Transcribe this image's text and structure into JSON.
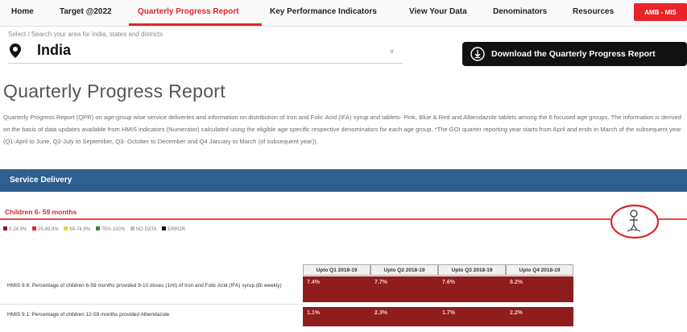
{
  "nav": {
    "items": [
      {
        "label": "Home"
      },
      {
        "label": "Target @2022"
      },
      {
        "label": "Quarterly Progress Report"
      },
      {
        "label": "Key Performance Indicators"
      },
      {
        "label": "View Your Data"
      },
      {
        "label": "Denominators"
      },
      {
        "label": "Resources"
      }
    ],
    "active_index": 2,
    "amb_label": "AMB - MIS"
  },
  "selector": {
    "breadcrumb": "Select / Search your area for India, states and districts",
    "value": "India",
    "chevron": "˅",
    "icon": "location-pin-icon"
  },
  "download": {
    "label": "Download the Quarterly Progress Report",
    "icon": "download-icon"
  },
  "page": {
    "title": "Quarterly Progress Report",
    "description": "Quarterly Progress Report (QPR) on age-group wise service deliveries and information on distribution of Iron and Folic Acid (IFA) syrup and tablets- Pink, Blue & Red and Albendazole tablets among the 6 focused age groups. The information is derived on the basis of data updates available from HMIS indicators (Numerator) calculated using the eligible age specific respective denominators for each age group. *The GOI quarter reporting year starts from April and ends in March of the subsequent year (Q1-April to June, Q2-July to September, Q3- October to December and Q4 January to March (of subsequent year))."
  },
  "service_delivery": {
    "label": "Service Delivery"
  },
  "section": {
    "title": "Children 6- 59 months",
    "emblem_icon": "child-emblem-icon"
  },
  "legend": [
    {
      "label": "0-24.9%",
      "color": "#8f1d1d"
    },
    {
      "label": "25-49.9%",
      "color": "#e8242b"
    },
    {
      "label": "50-74.9%",
      "color": "#f2d13a"
    },
    {
      "label": "75%-100%",
      "color": "#2e8b3a"
    },
    {
      "label": "NO DATA",
      "color": "#bdbdbd"
    },
    {
      "label": "ERROR",
      "color": "#111111"
    }
  ],
  "table": {
    "columns": [
      "Upto Q1 2018-19",
      "Upto Q2 2018-19",
      "Upto Q3 2018-19",
      "Upto Q4 2018-19"
    ],
    "rows": [
      {
        "label": "HMIS 9.8: Percentage of children 6-59 months provided 8-10 doses (1ml) of Iron and Folic Acid (IFA) syrup (Bi weekly)",
        "values": [
          "7.4%",
          "7.7%",
          "7.6%",
          "8.2%"
        ]
      },
      {
        "label": "HMIS 9.1: Percentage of children 12-59 months provided Albendazole",
        "values": [
          "1.1%",
          "2.3%",
          "1.7%",
          "2.2%"
        ]
      }
    ],
    "cell_color": "#8f1d1d"
  }
}
